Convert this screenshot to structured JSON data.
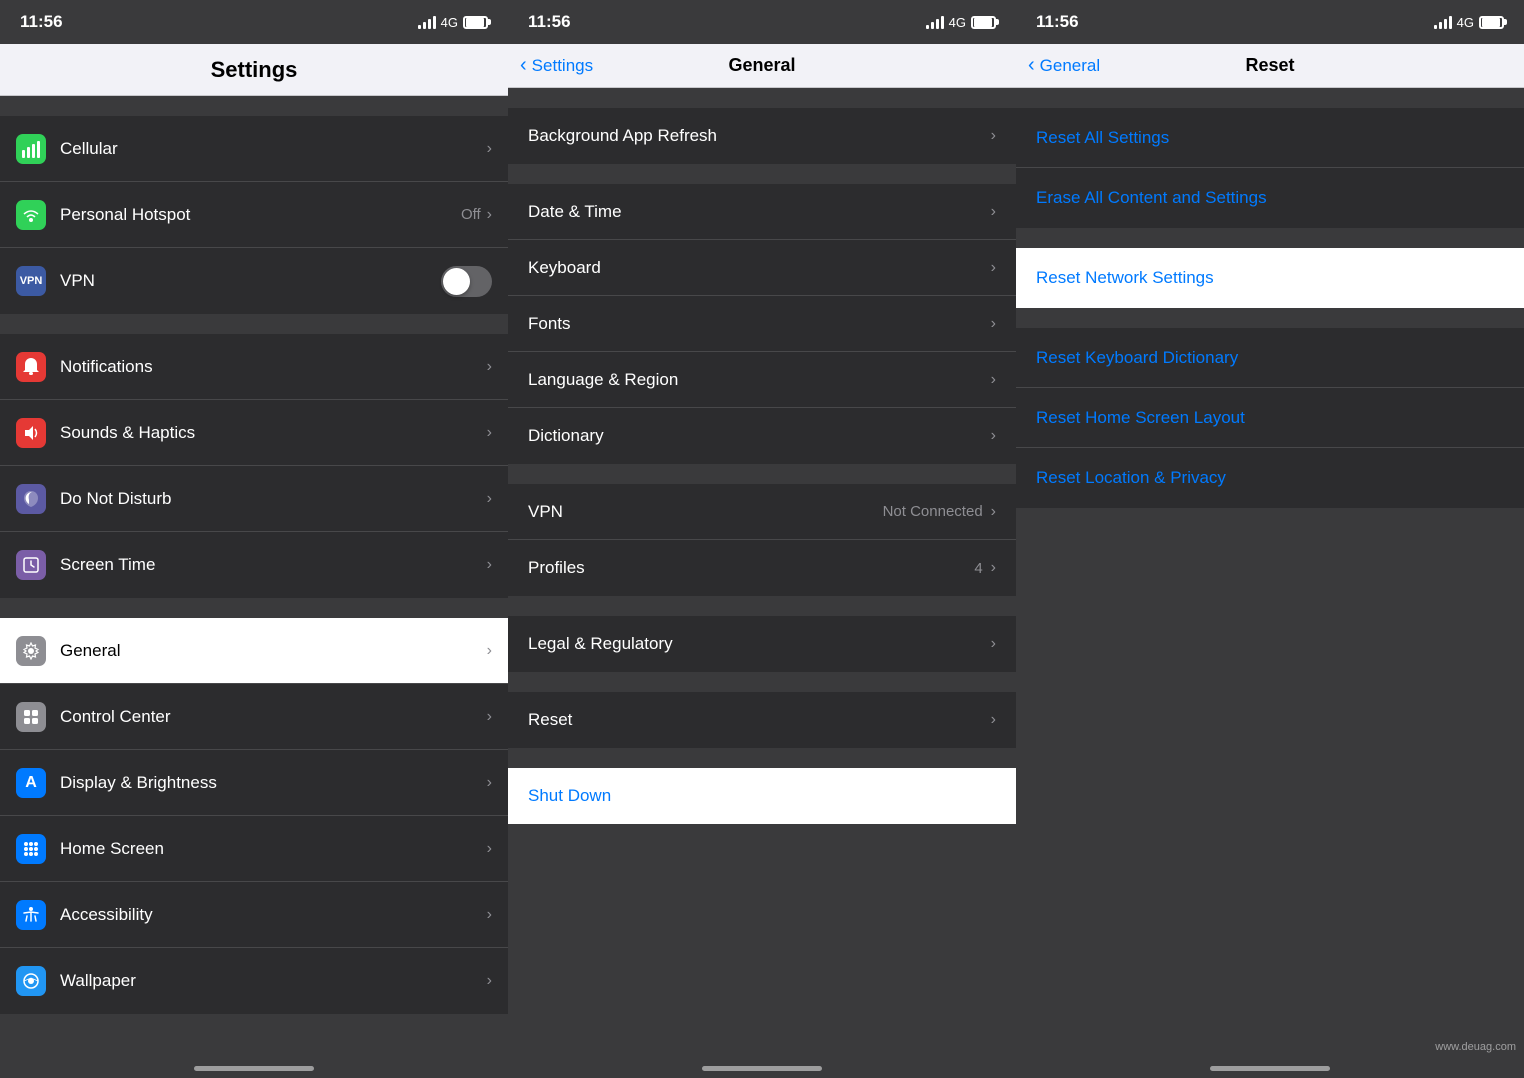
{
  "colors": {
    "blue": "#007aff",
    "bg_dark": "#3a3a3c",
    "cell_bg": "#2c2c2e",
    "separator": "#48484a",
    "white": "#ffffff",
    "text_primary": "#ffffff",
    "text_secondary": "#8e8e93",
    "nav_bg": "#f2f2f7"
  },
  "panel1": {
    "status_time": "11:56",
    "title": "Settings",
    "items": [
      {
        "id": "cellular",
        "label": "Cellular",
        "icon_color": "#30d158",
        "icon": "📶",
        "detail": ""
      },
      {
        "id": "personal_hotspot",
        "label": "Personal Hotspot",
        "icon_color": "#30d158",
        "icon": "🔗",
        "detail": "Off"
      },
      {
        "id": "vpn",
        "label": "VPN",
        "icon_color": "#3c5aa3",
        "icon": "🔒",
        "has_toggle": true
      },
      {
        "id": "notifications",
        "label": "Notifications",
        "icon_color": "#e53935",
        "icon": "🔔",
        "detail": ""
      },
      {
        "id": "sounds_haptics",
        "label": "Sounds & Haptics",
        "icon_color": "#e53935",
        "icon": "🔊",
        "detail": ""
      },
      {
        "id": "do_not_disturb",
        "label": "Do Not Disturb",
        "icon_color": "#5c5aa3",
        "icon": "🌙",
        "detail": ""
      },
      {
        "id": "screen_time",
        "label": "Screen Time",
        "icon_color": "#7b5ea7",
        "icon": "⏳",
        "detail": ""
      },
      {
        "id": "general",
        "label": "General",
        "icon_color": "#8e8e93",
        "icon": "⚙️",
        "detail": "",
        "active": true
      },
      {
        "id": "control_center",
        "label": "Control Center",
        "icon_color": "#8e8e93",
        "icon": "🎛",
        "detail": ""
      },
      {
        "id": "display_brightness",
        "label": "Display & Brightness",
        "icon_color": "#007aff",
        "icon": "A",
        "detail": ""
      },
      {
        "id": "home_screen",
        "label": "Home Screen",
        "icon_color": "#007aff",
        "icon": "⠿",
        "detail": ""
      },
      {
        "id": "accessibility",
        "label": "Accessibility",
        "icon_color": "#007aff",
        "icon": "♿",
        "detail": ""
      },
      {
        "id": "wallpaper",
        "label": "Wallpaper",
        "icon_color": "#2196f3",
        "icon": "🌸",
        "detail": ""
      }
    ]
  },
  "panel2": {
    "status_time": "11:56",
    "back_label": "Settings",
    "title": "General",
    "items_group1": [
      {
        "id": "background_app_refresh",
        "label": "Background App Refresh",
        "detail": ""
      },
      {
        "id": "date_time",
        "label": "Date & Time",
        "detail": ""
      },
      {
        "id": "keyboard",
        "label": "Keyboard",
        "detail": ""
      },
      {
        "id": "fonts",
        "label": "Fonts",
        "detail": ""
      },
      {
        "id": "language_region",
        "label": "Language & Region",
        "detail": ""
      },
      {
        "id": "dictionary",
        "label": "Dictionary",
        "detail": ""
      }
    ],
    "items_group2": [
      {
        "id": "vpn2",
        "label": "VPN",
        "detail": "Not Connected"
      },
      {
        "id": "profiles",
        "label": "Profiles",
        "detail": "4"
      }
    ],
    "items_group3": [
      {
        "id": "legal_regulatory",
        "label": "Legal & Regulatory",
        "detail": ""
      }
    ],
    "items_group4": [
      {
        "id": "reset",
        "label": "Reset",
        "detail": ""
      }
    ],
    "items_group5": [
      {
        "id": "shut_down",
        "label": "Shut Down",
        "is_blue": true
      }
    ]
  },
  "panel3": {
    "status_time": "11:56",
    "back_label": "General",
    "title": "Reset",
    "items_group1": [
      {
        "id": "reset_all_settings",
        "label": "Reset All Settings"
      },
      {
        "id": "erase_all_content",
        "label": "Erase All Content and Settings"
      }
    ],
    "items_group2": [
      {
        "id": "reset_network_settings",
        "label": "Reset Network Settings",
        "active": true
      }
    ],
    "items_group3": [
      {
        "id": "reset_keyboard_dictionary",
        "label": "Reset Keyboard Dictionary"
      },
      {
        "id": "reset_home_screen_layout",
        "label": "Reset Home Screen Layout"
      },
      {
        "id": "reset_location_privacy",
        "label": "Reset Location & Privacy"
      }
    ]
  },
  "watermark": "www.deuag.com"
}
